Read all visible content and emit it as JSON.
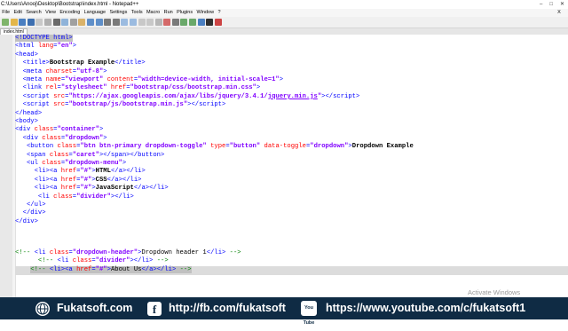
{
  "window": {
    "title": "C:\\Users\\Anooj\\Desktop\\Bootstrap\\index.html - Notepad++",
    "controls": [
      "–",
      "□",
      "✕"
    ]
  },
  "menu": [
    "File",
    "Edit",
    "Search",
    "View",
    "Encoding",
    "Language",
    "Settings",
    "Tools",
    "Macro",
    "Run",
    "Plugins",
    "Window",
    "?"
  ],
  "menu_close": "X",
  "tab": {
    "label": "index.html"
  },
  "watermark": "Activate Windows",
  "footer": {
    "site": "Fukatsoft.com",
    "facebook": "http://fb.com/fukatsoft",
    "youtube": "https://www.youtube.com/c/fukatsoft1",
    "yt_icon_label": "You Tube"
  }
}
